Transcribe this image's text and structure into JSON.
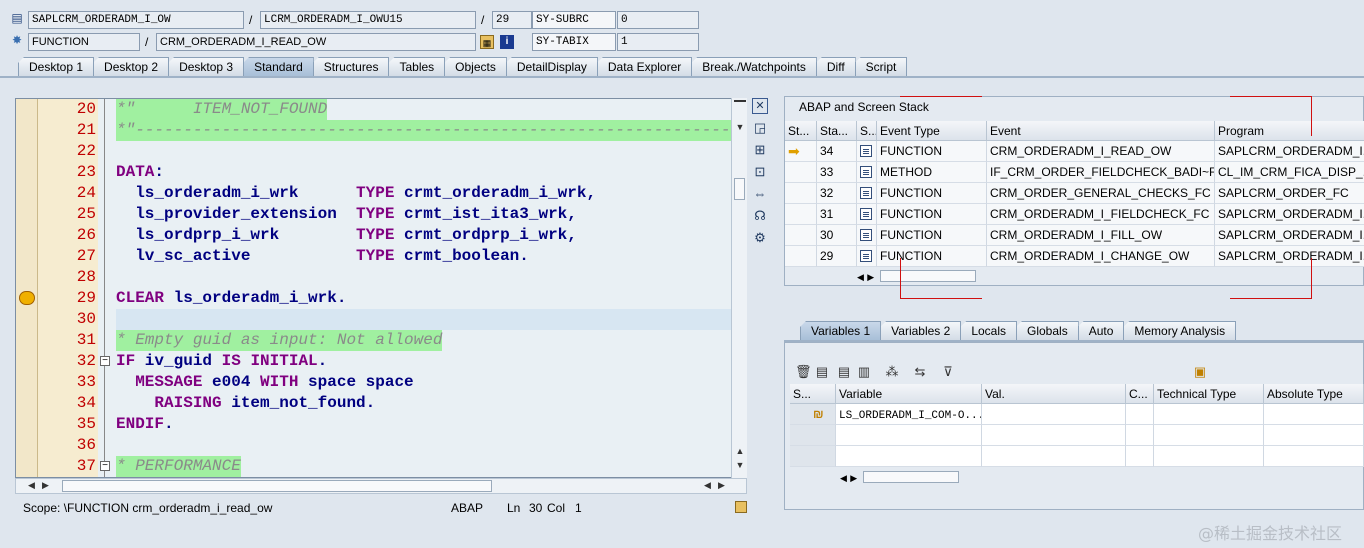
{
  "header": {
    "row1": {
      "program": "SAPLCRM_ORDERADM_I_OW",
      "include": "LCRM_ORDERADM_I_OWU15",
      "line": "29",
      "sysfield_name": "SY-SUBRC",
      "sysfield_value": "0"
    },
    "row2": {
      "type": "FUNCTION",
      "name": "CRM_ORDERADM_I_READ_OW",
      "sysfield_name": "SY-TABIX",
      "sysfield_value": "1"
    },
    "separator": "/"
  },
  "tabs": [
    {
      "label": "Desktop 1"
    },
    {
      "label": "Desktop 2"
    },
    {
      "label": "Desktop 3"
    },
    {
      "label": "Standard",
      "active": true
    },
    {
      "label": "Structures"
    },
    {
      "label": "Tables"
    },
    {
      "label": "Objects"
    },
    {
      "label": "DetailDisplay"
    },
    {
      "label": "Data Explorer"
    },
    {
      "label": "Break./Watchpoints"
    },
    {
      "label": "Diff"
    },
    {
      "label": "Script"
    }
  ],
  "editor": {
    "lines": [
      {
        "num": "20",
        "text": "*\"      ITEM_NOT_FOUND"
      },
      {
        "num": "21",
        "text": "*\"----------------------------------------------------------------"
      },
      {
        "num": "22",
        "text": ""
      },
      {
        "num": "23",
        "text": "DATA:"
      },
      {
        "num": "24",
        "text": "  ls_orderadm_i_wrk      TYPE crmt_orderadm_i_wrk,"
      },
      {
        "num": "25",
        "text": "  ls_provider_extension  TYPE crmt_ist_ita3_wrk,"
      },
      {
        "num": "26",
        "text": "  ls_ordprp_i_wrk        TYPE crmt_ordprp_i_wrk,"
      },
      {
        "num": "27",
        "text": "  lv_sc_active           TYPE crmt_boolean."
      },
      {
        "num": "28",
        "text": ""
      },
      {
        "num": "29",
        "text": "CLEAR ls_orderadm_i_wrk."
      },
      {
        "num": "30",
        "text": ""
      },
      {
        "num": "31",
        "text": "* Empty guid as input: Not allowed"
      },
      {
        "num": "32",
        "text": "IF iv_guid IS INITIAL."
      },
      {
        "num": "33",
        "text": "  MESSAGE e004 WITH space space"
      },
      {
        "num": "34",
        "text": "    RAISING item_not_found."
      },
      {
        "num": "35",
        "text": "ENDIF."
      },
      {
        "num": "36",
        "text": ""
      },
      {
        "num": "37",
        "text": "* PERFORMANCE"
      }
    ]
  },
  "status": {
    "scope": "Scope: \\FUNCTION crm_orderadm_i_read_ow",
    "lang": "ABAP",
    "ln_label": "Ln",
    "ln": "30",
    "col_label": "Col",
    "col": "1"
  },
  "stack": {
    "title": "ABAP and Screen Stack",
    "columns": [
      "St...",
      "Sta...",
      "S...",
      "Event Type",
      "Event",
      "Program"
    ],
    "rows": [
      {
        "level": "34",
        "type": "FUNCTION",
        "event": "CRM_ORDERADM_I_READ_OW",
        "program": "SAPLCRM_ORDERADM_I..."
      },
      {
        "level": "33",
        "type": "METHOD",
        "event": "IF_CRM_ORDER_FIELDCHECK_BADI~FIE...",
        "program": "CL_IM_CRM_FICA_DISP_..."
      },
      {
        "level": "32",
        "type": "FUNCTION",
        "event": "CRM_ORDER_GENERAL_CHECKS_FC",
        "program": "SAPLCRM_ORDER_FC"
      },
      {
        "level": "31",
        "type": "FUNCTION",
        "event": "CRM_ORDERADM_I_FIELDCHECK_FC",
        "program": "SAPLCRM_ORDERADM_I..."
      },
      {
        "level": "30",
        "type": "FUNCTION",
        "event": "CRM_ORDERADM_I_FILL_OW",
        "program": "SAPLCRM_ORDERADM_I..."
      },
      {
        "level": "29",
        "type": "FUNCTION",
        "event": "CRM_ORDERADM_I_CHANGE_OW",
        "program": "SAPLCRM_ORDERADM_I..."
      }
    ]
  },
  "vartabs": [
    {
      "label": "Variables 1",
      "active": true
    },
    {
      "label": "Variables 2"
    },
    {
      "label": "Locals"
    },
    {
      "label": "Globals"
    },
    {
      "label": "Auto"
    },
    {
      "label": "Memory Analysis"
    }
  ],
  "vars": {
    "columns": [
      "S...",
      "Variable",
      "Val.",
      "C...",
      "Technical Type",
      "Absolute Type"
    ],
    "rows": [
      {
        "variable": "LS_ORDERADM_I_COM-O..."
      }
    ]
  },
  "watermark": "@稀土掘金技术社区"
}
